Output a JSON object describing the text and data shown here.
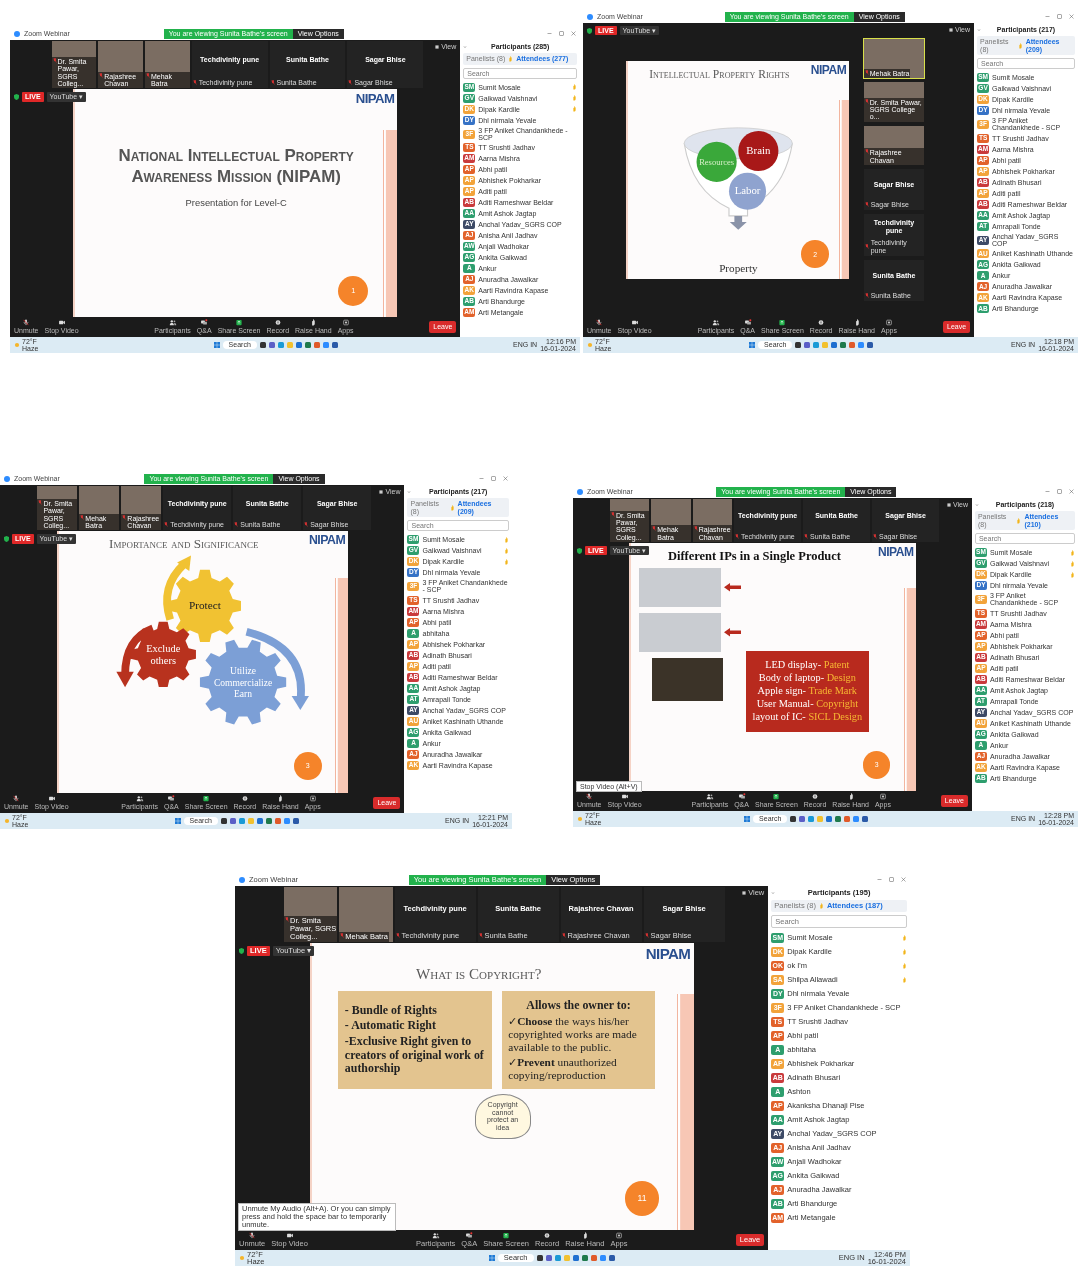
{
  "shots": [
    {
      "kind": "strip",
      "window_title": "Zoom Webinar",
      "banner": "You are viewing Sunita Bathe's screen",
      "view_options": "View Options",
      "view_button": "View",
      "videos": [
        {
          "kind": "camera",
          "label": "Dr. Smita Pawar, SGRS Colleg...",
          "active": false
        },
        {
          "kind": "camera",
          "label": "Rajashree Chavan",
          "active": false
        },
        {
          "kind": "camera",
          "label": "Mehak Batra",
          "active": false
        },
        {
          "kind": "name",
          "name": "Techdivinity pune",
          "label": "Techdivinity pune",
          "active": false
        },
        {
          "kind": "name",
          "name": "Sunita Bathe",
          "label": "Sunita Bathe",
          "active": false
        },
        {
          "kind": "name",
          "name": "Sagar Bhise",
          "label": "Sagar Bhise",
          "active": false
        }
      ],
      "live": "LIVE",
      "youtube": "YouTube ▾",
      "slide": {
        "kind": "title",
        "heading": "National Intellectual Property Awareness Mission (NIPAM)",
        "subtitle": "Presentation for Level-C",
        "logo": "NIPAM",
        "page": "1"
      },
      "toolbar_left": [
        {
          "kind": "mic",
          "label": "Unmute"
        },
        {
          "kind": "video",
          "label": "Stop Video"
        }
      ],
      "toolbar_center": [
        {
          "kind": "participants",
          "label": "Participants"
        },
        {
          "kind": "qa",
          "label": "Q&A"
        },
        {
          "kind": "share",
          "label": "Share Screen"
        },
        {
          "kind": "record",
          "label": "Record"
        },
        {
          "kind": "hand",
          "label": "Raise Hand"
        },
        {
          "kind": "apps",
          "label": "Apps"
        }
      ],
      "leave": "Leave",
      "participants": {
        "title": "Participants (285)",
        "tabs": [
          {
            "label": "Panelists (8)",
            "selected": false
          },
          {
            "label": "Attendees (277)",
            "selected": true
          }
        ],
        "placeholder": "Search",
        "people": [
          {
            "initials": "SM",
            "name": "Sumit Mosale",
            "color": "#2e9e6e",
            "hand": true
          },
          {
            "initials": "GV",
            "name": "Gaikwad Vaishnavi",
            "color": "#2e9e6e",
            "hand": true
          },
          {
            "initials": "DK",
            "name": "Dipak Kardile",
            "color": "#f2a33a",
            "hand": true
          },
          {
            "initials": "DY",
            "name": "Dhl nirmala Yevale",
            "color": "#3572c6",
            "hand": false
          },
          {
            "initials": "3F",
            "name": "3 FP Aniket Chandankhede - SCP",
            "color": "#f2a33a",
            "hand": false
          },
          {
            "initials": "TS",
            "name": "TT Srushti Jadhav",
            "color": "#e2622b",
            "hand": false
          },
          {
            "initials": "AM",
            "name": "Aarna Mishra",
            "color": "#c93a3c",
            "hand": false
          },
          {
            "initials": "AP",
            "name": "Abhi patil",
            "color": "#e2622b",
            "hand": false
          },
          {
            "initials": "AP",
            "name": "Abhishek Pokharkar",
            "color": "#f2a33a",
            "hand": false
          },
          {
            "initials": "AP",
            "name": "Aditi patil",
            "color": "#f2a33a",
            "hand": false
          },
          {
            "initials": "AB",
            "name": "Aditi Rameshwar Beldar",
            "color": "#c93a3c",
            "hand": false
          },
          {
            "initials": "AA",
            "name": "Amit Ashok Jagtap",
            "color": "#2e9e6e",
            "hand": false
          },
          {
            "initials": "AY",
            "name": "Anchal Yadav_SGRS COP",
            "color": "#3d4a66",
            "hand": false
          },
          {
            "initials": "AJ",
            "name": "Anisha Anil Jadhav",
            "color": "#e2622b",
            "hand": false
          },
          {
            "initials": "AW",
            "name": "Anjali Wadhokar",
            "color": "#2e9e6e",
            "hand": false
          },
          {
            "initials": "AG",
            "name": "Ankita Gaikwad",
            "color": "#2e9e6e",
            "hand": false
          },
          {
            "initials": "A",
            "name": "Ankur",
            "color": "#2e9e6e",
            "hand": false
          },
          {
            "initials": "AJ",
            "name": "Anuradha Jawalkar",
            "color": "#e2622b",
            "hand": false
          },
          {
            "initials": "AK",
            "name": "Aarti Ravindra Kapase",
            "color": "#f2a33a",
            "hand": false
          },
          {
            "initials": "AB",
            "name": "Arti Bhandurge",
            "color": "#2e9e6e",
            "hand": false
          },
          {
            "initials": "AM",
            "name": "Arti Metangale",
            "color": "#e2622b",
            "hand": false
          }
        ]
      },
      "taskbar": {
        "weather": "72°F",
        "condition": "Haze",
        "search": "Search",
        "lang": "ENG IN",
        "time": "12:16 PM",
        "date": "16-01-2024"
      }
    },
    {
      "kind": "side",
      "window_title": "Zoom Webinar",
      "banner": "You are viewing Sunita Bathe's screen",
      "view_options": "View Options",
      "view_button": "View",
      "videos": [
        {
          "kind": "camera",
          "label": "Mehak Batra",
          "active": true
        },
        {
          "kind": "camera",
          "label": "Dr. Smita Pawar, SGRS College o...",
          "active": false
        },
        {
          "kind": "camera",
          "label": "Rajashree Chavan",
          "active": false
        },
        {
          "kind": "name",
          "name": "Sagar Bhise",
          "label": "Sagar Bhise",
          "active": false
        },
        {
          "kind": "name",
          "name": "Techdivinity pune",
          "label": "Techdivinity pune",
          "active": false
        },
        {
          "kind": "name",
          "name": "Sunita Bathe",
          "label": "Sunita Bathe",
          "active": false
        }
      ],
      "live": "LIVE",
      "youtube": "YouTube ▾",
      "slide": {
        "kind": "funnel",
        "heading": "Intellectual Property Rights",
        "bubbles": [
          "Resources",
          "Brain",
          "Labor"
        ],
        "result": "Property",
        "logo": "NIPAM",
        "page": "2"
      },
      "toolbar_left": [
        {
          "kind": "mic",
          "label": "Unmute"
        },
        {
          "kind": "video",
          "label": "Stop Video"
        }
      ],
      "toolbar_center": [
        {
          "kind": "participants",
          "label": "Participants"
        },
        {
          "kind": "qa",
          "label": "Q&A"
        },
        {
          "kind": "share",
          "label": "Share Screen"
        },
        {
          "kind": "record",
          "label": "Record"
        },
        {
          "kind": "hand",
          "label": "Raise Hand"
        },
        {
          "kind": "apps",
          "label": "Apps"
        }
      ],
      "leave": "Leave",
      "participants": {
        "title": "Participants (217)",
        "tabs": [
          {
            "label": "Panelists (8)",
            "selected": false
          },
          {
            "label": "Attendees (209)",
            "selected": true
          }
        ],
        "placeholder": "Search",
        "people": [
          {
            "initials": "SM",
            "name": "Sumit Mosale",
            "color": "#2e9e6e",
            "hand": false
          },
          {
            "initials": "GV",
            "name": "Gaikwad Vaishnavi",
            "color": "#2e9e6e",
            "hand": false
          },
          {
            "initials": "DK",
            "name": "Dipak Kardile",
            "color": "#f2a33a",
            "hand": false
          },
          {
            "initials": "DY",
            "name": "Dhl nirmala Yevale",
            "color": "#3572c6",
            "hand": false
          },
          {
            "initials": "3F",
            "name": "3 FP Aniket Chandankhede - SCP",
            "color": "#f2a33a",
            "hand": false
          },
          {
            "initials": "TS",
            "name": "TT Srushti Jadhav",
            "color": "#e2622b",
            "hand": false
          },
          {
            "initials": "AM",
            "name": "Aarna Mishra",
            "color": "#c93a3c",
            "hand": false
          },
          {
            "initials": "AP",
            "name": "Abhi patil",
            "color": "#e2622b",
            "hand": false
          },
          {
            "initials": "AP",
            "name": "Abhishek Pokharkar",
            "color": "#f2a33a",
            "hand": false
          },
          {
            "initials": "AB",
            "name": "Adinath Bhusari",
            "color": "#c93a3c",
            "hand": false
          },
          {
            "initials": "AP",
            "name": "Aditi patil",
            "color": "#f2a33a",
            "hand": false
          },
          {
            "initials": "AB",
            "name": "Aditi Rameshwar Beldar",
            "color": "#c93a3c",
            "hand": false
          },
          {
            "initials": "AA",
            "name": "Amit Ashok Jagtap",
            "color": "#2e9e6e",
            "hand": false
          },
          {
            "initials": "AT",
            "name": "Amrapali Tonde",
            "color": "#2e9e6e",
            "hand": false
          },
          {
            "initials": "AY",
            "name": "Anchal Yadav_SGRS COP",
            "color": "#3d4a66",
            "hand": false
          },
          {
            "initials": "AU",
            "name": "Aniket Kashinath Uthande",
            "color": "#f2a33a",
            "hand": false
          },
          {
            "initials": "AG",
            "name": "Ankita Gaikwad",
            "color": "#2e9e6e",
            "hand": false
          },
          {
            "initials": "A",
            "name": "Ankur",
            "color": "#2e9e6e",
            "hand": false
          },
          {
            "initials": "AJ",
            "name": "Anuradha Jawalkar",
            "color": "#e2622b",
            "hand": false
          },
          {
            "initials": "AK",
            "name": "Aarti Ravindra Kapase",
            "color": "#f2a33a",
            "hand": false
          },
          {
            "initials": "AB",
            "name": "Arti Bhandurge",
            "color": "#2e9e6e",
            "hand": false
          }
        ]
      },
      "taskbar": {
        "weather": "72°F",
        "condition": "Haze",
        "search": "Search",
        "lang": "ENG IN",
        "time": "12:18 PM",
        "date": "16-01-2024"
      }
    },
    {
      "kind": "strip",
      "window_title": "Zoom Webinar",
      "banner": "You are viewing Sunita Bathe's screen",
      "view_options": "View Options",
      "view_button": "View",
      "videos": [
        {
          "kind": "camera",
          "label": "Dr. Smita Pawar, SGRS Colleg...",
          "active": false
        },
        {
          "kind": "camera",
          "label": "Mehak Batra",
          "active": false
        },
        {
          "kind": "camera",
          "label": "Rajashree Chavan",
          "active": false
        },
        {
          "kind": "name",
          "name": "Techdivinity pune",
          "label": "Techdivinity pune",
          "active": false
        },
        {
          "kind": "name",
          "name": "Sunita Bathe",
          "label": "Sunita Bathe",
          "active": false
        },
        {
          "kind": "name",
          "name": "Sagar Bhise",
          "label": "Sagar Bhise",
          "active": false
        }
      ],
      "live": "LIVE",
      "youtube": "YouTube ▾",
      "slide": {
        "kind": "gears",
        "heading": "Importance and Significance",
        "gears": [
          "Protect",
          "Exclude others",
          "Utilize Commercialize Earn"
        ],
        "logo": "NIPAM",
        "page": "3"
      },
      "toolbar_left": [
        {
          "kind": "mic",
          "label": "Unmute"
        },
        {
          "kind": "video",
          "label": "Stop Video"
        }
      ],
      "toolbar_center": [
        {
          "kind": "participants",
          "label": "Participants"
        },
        {
          "kind": "qa",
          "label": "Q&A"
        },
        {
          "kind": "share",
          "label": "Share Screen"
        },
        {
          "kind": "record",
          "label": "Record"
        },
        {
          "kind": "hand",
          "label": "Raise Hand"
        },
        {
          "kind": "apps",
          "label": "Apps"
        }
      ],
      "leave": "Leave",
      "participants": {
        "title": "Participants (217)",
        "tabs": [
          {
            "label": "Panelists (8)",
            "selected": false
          },
          {
            "label": "Attendees (209)",
            "selected": true
          }
        ],
        "placeholder": "Search",
        "people": [
          {
            "initials": "SM",
            "name": "Sumit Mosale",
            "color": "#2e9e6e",
            "hand": true
          },
          {
            "initials": "GV",
            "name": "Gaikwad Vaishnavi",
            "color": "#2e9e6e",
            "hand": true
          },
          {
            "initials": "DK",
            "name": "Dipak Kardile",
            "color": "#f2a33a",
            "hand": true
          },
          {
            "initials": "DY",
            "name": "Dhl nirmala Yevale",
            "color": "#3572c6",
            "hand": false
          },
          {
            "initials": "3F",
            "name": "3 FP Aniket Chandankhede - SCP",
            "color": "#f2a33a",
            "hand": false
          },
          {
            "initials": "TS",
            "name": "TT Srushti Jadhav",
            "color": "#e2622b",
            "hand": false
          },
          {
            "initials": "AM",
            "name": "Aarna Mishra",
            "color": "#c93a3c",
            "hand": false
          },
          {
            "initials": "AP",
            "name": "Abhi patil",
            "color": "#e2622b",
            "hand": false
          },
          {
            "initials": "A",
            "name": "abhitaha",
            "color": "#2e9e6e",
            "hand": false
          },
          {
            "initials": "AP",
            "name": "Abhishek Pokharkar",
            "color": "#f2a33a",
            "hand": false
          },
          {
            "initials": "AB",
            "name": "Adinath Bhusari",
            "color": "#c93a3c",
            "hand": false
          },
          {
            "initials": "AP",
            "name": "Aditi patil",
            "color": "#f2a33a",
            "hand": false
          },
          {
            "initials": "AB",
            "name": "Aditi Rameshwar Beldar",
            "color": "#c93a3c",
            "hand": false
          },
          {
            "initials": "AA",
            "name": "Amit Ashok Jagtap",
            "color": "#2e9e6e",
            "hand": false
          },
          {
            "initials": "AT",
            "name": "Amrapali Tonde",
            "color": "#2e9e6e",
            "hand": false
          },
          {
            "initials": "AY",
            "name": "Anchal Yadav_SGRS COP",
            "color": "#3d4a66",
            "hand": false
          },
          {
            "initials": "AU",
            "name": "Aniket Kashinath Uthande",
            "color": "#f2a33a",
            "hand": false
          },
          {
            "initials": "AG",
            "name": "Ankita Gaikwad",
            "color": "#2e9e6e",
            "hand": false
          },
          {
            "initials": "A",
            "name": "Ankur",
            "color": "#2e9e6e",
            "hand": false
          },
          {
            "initials": "AJ",
            "name": "Anuradha Jawalkar",
            "color": "#e2622b",
            "hand": false
          },
          {
            "initials": "AK",
            "name": "Aarti Ravindra Kapase",
            "color": "#f2a33a",
            "hand": false
          }
        ]
      },
      "taskbar": {
        "weather": "72°F",
        "condition": "Haze",
        "search": "Search",
        "lang": "ENG IN",
        "time": "12:21 PM",
        "date": "16-01-2024"
      }
    },
    {
      "kind": "strip",
      "window_title": "Zoom Webinar",
      "banner": "You are viewing Sunita Bathe's screen",
      "view_options": "View Options",
      "view_button": "View",
      "videos": [
        {
          "kind": "camera",
          "label": "Dr. Smita Pawar, SGRS Colleg...",
          "active": false
        },
        {
          "kind": "camera",
          "label": "Mehak Batra",
          "active": false
        },
        {
          "kind": "camera",
          "label": "Rajashree Chavan",
          "active": false
        },
        {
          "kind": "name",
          "name": "Techdivinity pune",
          "label": "Techdivinity pune",
          "active": false
        },
        {
          "kind": "name",
          "name": "Sunita Bathe",
          "label": "Sunita Bathe",
          "active": false
        },
        {
          "kind": "name",
          "name": "Sagar Bhise",
          "label": "Sagar Bhise",
          "active": false
        }
      ],
      "live": "LIVE",
      "youtube": "YouTube ▾",
      "slide": {
        "kind": "product",
        "heading": "Different IPs in a Single Product",
        "lines": [
          {
            "item": "LED display-",
            "ip": "Patent"
          },
          {
            "item": "Body of laptop-",
            "ip": "Design"
          },
          {
            "item": "Apple sign-",
            "ip": "Trade Mark"
          },
          {
            "item": "User Manual-",
            "ip": "Copyright"
          },
          {
            "item": "layout of IC-",
            "ip": "SICL Design"
          }
        ],
        "logo": "NIPAM",
        "page": "3"
      },
      "toolbar_left": [
        {
          "kind": "mic",
          "label": "Unmute"
        },
        {
          "kind": "video",
          "label": "Stop Video"
        }
      ],
      "toolbar_center": [
        {
          "kind": "participants",
          "label": "Participants"
        },
        {
          "kind": "qa",
          "label": "Q&A"
        },
        {
          "kind": "share",
          "label": "Share Screen"
        },
        {
          "kind": "record",
          "label": "Record"
        },
        {
          "kind": "hand",
          "label": "Raise Hand"
        },
        {
          "kind": "apps",
          "label": "Apps"
        }
      ],
      "leave": "Leave",
      "tooltip": "Stop Video (Alt+V)",
      "participants": {
        "title": "Participants (218)",
        "tabs": [
          {
            "label": "Panelists (8)",
            "selected": false
          },
          {
            "label": "Attendees (210)",
            "selected": true
          }
        ],
        "placeholder": "Search",
        "people": [
          {
            "initials": "SM",
            "name": "Sumit Mosale",
            "color": "#2e9e6e",
            "hand": true
          },
          {
            "initials": "GV",
            "name": "Gaikwad Vaishnavi",
            "color": "#2e9e6e",
            "hand": true
          },
          {
            "initials": "DK",
            "name": "Dipak Kardile",
            "color": "#f2a33a",
            "hand": true
          },
          {
            "initials": "DY",
            "name": "Dhl nirmala Yevale",
            "color": "#3572c6",
            "hand": false
          },
          {
            "initials": "3F",
            "name": "3 FP Aniket Chandankhede - SCP",
            "color": "#f2a33a",
            "hand": false
          },
          {
            "initials": "TS",
            "name": "TT Srushti Jadhav",
            "color": "#e2622b",
            "hand": false
          },
          {
            "initials": "AM",
            "name": "Aarna Mishra",
            "color": "#c93a3c",
            "hand": false
          },
          {
            "initials": "AP",
            "name": "Abhi patil",
            "color": "#e2622b",
            "hand": false
          },
          {
            "initials": "AP",
            "name": "Abhishek Pokharkar",
            "color": "#f2a33a",
            "hand": false
          },
          {
            "initials": "AB",
            "name": "Adinath Bhusari",
            "color": "#c93a3c",
            "hand": false
          },
          {
            "initials": "AP",
            "name": "Aditi patil",
            "color": "#f2a33a",
            "hand": false
          },
          {
            "initials": "AB",
            "name": "Aditi Rameshwar Beldar",
            "color": "#c93a3c",
            "hand": false
          },
          {
            "initials": "AA",
            "name": "Amit Ashok Jagtap",
            "color": "#2e9e6e",
            "hand": false
          },
          {
            "initials": "AT",
            "name": "Amrapali Tonde",
            "color": "#2e9e6e",
            "hand": false
          },
          {
            "initials": "AY",
            "name": "Anchal Yadav_SGRS COP",
            "color": "#3d4a66",
            "hand": false
          },
          {
            "initials": "AU",
            "name": "Aniket Kashinath Uthande",
            "color": "#f2a33a",
            "hand": false
          },
          {
            "initials": "AG",
            "name": "Ankita Gaikwad",
            "color": "#2e9e6e",
            "hand": false
          },
          {
            "initials": "A",
            "name": "Ankur",
            "color": "#2e9e6e",
            "hand": false
          },
          {
            "initials": "AJ",
            "name": "Anuradha Jawalkar",
            "color": "#e2622b",
            "hand": false
          },
          {
            "initials": "AK",
            "name": "Aarti Ravindra Kapase",
            "color": "#f2a33a",
            "hand": false
          },
          {
            "initials": "AB",
            "name": "Arti Bhandurge",
            "color": "#2e9e6e",
            "hand": false
          }
        ]
      },
      "taskbar": {
        "weather": "72°F",
        "condition": "Haze",
        "search": "Search",
        "lang": "ENG IN",
        "time": "12:28 PM",
        "date": "16-01-2024"
      }
    },
    {
      "kind": "strip",
      "window_title": "Zoom Webinar",
      "banner": "You are viewing Sunita Bathe's screen",
      "view_options": "View Options",
      "view_button": "View",
      "videos": [
        {
          "kind": "camera",
          "label": "Dr. Smita Pawar, SGRS Colleg...",
          "active": false
        },
        {
          "kind": "camera",
          "label": "Mehak Batra",
          "active": false
        },
        {
          "kind": "name",
          "name": "Techdivinity pune",
          "label": "Techdivinity pune",
          "active": false
        },
        {
          "kind": "name",
          "name": "Sunita Bathe",
          "label": "Sunita Bathe",
          "active": false
        },
        {
          "kind": "name",
          "name": "Rajashree Chavan",
          "label": "Rajashree Chavan",
          "active": false
        },
        {
          "kind": "name",
          "name": "Sagar Bhise",
          "label": "Sagar Bhise",
          "active": false
        }
      ],
      "live": "LIVE",
      "youtube": "YouTube ▾",
      "slide": {
        "kind": "copyright",
        "heading": "What is Copyright?",
        "left": [
          "- Bundle of Rights",
          "- Automatic Right",
          "-Exclusive Right given to creators of original work of authorship"
        ],
        "right_heading": "Allows the owner to:",
        "right": [
          "✓**Choose** the ways his/her copyrighted works are made available to the public.",
          "✓**Prevent** unauthorized copying/reproduction"
        ],
        "bulb": "Copyright cannot protect an idea",
        "logo": "NIPAM",
        "page": "11"
      },
      "toolbar_left": [
        {
          "kind": "mic",
          "label": "Unmute"
        },
        {
          "kind": "video",
          "label": "Stop Video"
        }
      ],
      "toolbar_center": [
        {
          "kind": "participants",
          "label": "Participants"
        },
        {
          "kind": "qa",
          "label": "Q&A"
        },
        {
          "kind": "share",
          "label": "Share Screen"
        },
        {
          "kind": "record",
          "label": "Record"
        },
        {
          "kind": "hand",
          "label": "Raise Hand"
        },
        {
          "kind": "apps",
          "label": "Apps"
        }
      ],
      "leave": "Leave",
      "tooltip": "Unmute My Audio (Alt+A). Or you can simply press and hold the space bar to temporarily unmute.",
      "participants": {
        "title": "Participants (195)",
        "tabs": [
          {
            "label": "Panelists (8)",
            "selected": false
          },
          {
            "label": "Attendees (187)",
            "selected": true
          }
        ],
        "placeholder": "Search",
        "people": [
          {
            "initials": "SM",
            "name": "Sumit Mosale",
            "color": "#2e9e6e",
            "hand": true
          },
          {
            "initials": "DK",
            "name": "Dipak Kardile",
            "color": "#f2a33a",
            "hand": true
          },
          {
            "initials": "OK",
            "name": "ok I'm",
            "color": "#e2622b",
            "hand": true
          },
          {
            "initials": "SA",
            "name": "Shilpa Allawadi",
            "color": "#f2a33a",
            "hand": true
          },
          {
            "initials": "DY",
            "name": "Dhl nirmala Yevale",
            "color": "#2e9e6e",
            "hand": false
          },
          {
            "initials": "3F",
            "name": "3 FP Aniket Chandankhede - SCP",
            "color": "#f2a33a",
            "hand": false
          },
          {
            "initials": "TS",
            "name": "TT Srushti Jadhav",
            "color": "#e2622b",
            "hand": false
          },
          {
            "initials": "AP",
            "name": "Abhi patil",
            "color": "#e2622b",
            "hand": false
          },
          {
            "initials": "A",
            "name": "abhitaha",
            "color": "#2e9e6e",
            "hand": false
          },
          {
            "initials": "AP",
            "name": "Abhishek Pokharkar",
            "color": "#f2a33a",
            "hand": false
          },
          {
            "initials": "AB",
            "name": "Adinath Bhusari",
            "color": "#c93a3c",
            "hand": false
          },
          {
            "initials": "A",
            "name": "Ashton",
            "color": "#2e9e6e",
            "hand": false
          },
          {
            "initials": "AP",
            "name": "Akanksha Dhanaji Pise",
            "color": "#e2622b",
            "hand": false
          },
          {
            "initials": "AA",
            "name": "Amit Ashok Jagtap",
            "color": "#2e9e6e",
            "hand": false
          },
          {
            "initials": "AY",
            "name": "Anchal Yadav_SGRS COP",
            "color": "#3d4a66",
            "hand": false
          },
          {
            "initials": "AJ",
            "name": "Anisha Anil Jadhav",
            "color": "#e2622b",
            "hand": false
          },
          {
            "initials": "AW",
            "name": "Anjali Wadhokar",
            "color": "#2e9e6e",
            "hand": false
          },
          {
            "initials": "AG",
            "name": "Ankita Gaikwad",
            "color": "#2e9e6e",
            "hand": false
          },
          {
            "initials": "AJ",
            "name": "Anuradha Jawalkar",
            "color": "#e2622b",
            "hand": false
          },
          {
            "initials": "AB",
            "name": "Arti Bhandurge",
            "color": "#2e9e6e",
            "hand": false
          },
          {
            "initials": "AM",
            "name": "Arti Metangale",
            "color": "#e2622b",
            "hand": false
          }
        ]
      },
      "taskbar": {
        "weather": "72°F",
        "condition": "Haze",
        "search": "Search",
        "lang": "ENG IN",
        "time": "12:46 PM",
        "date": "16-01-2024"
      }
    }
  ]
}
